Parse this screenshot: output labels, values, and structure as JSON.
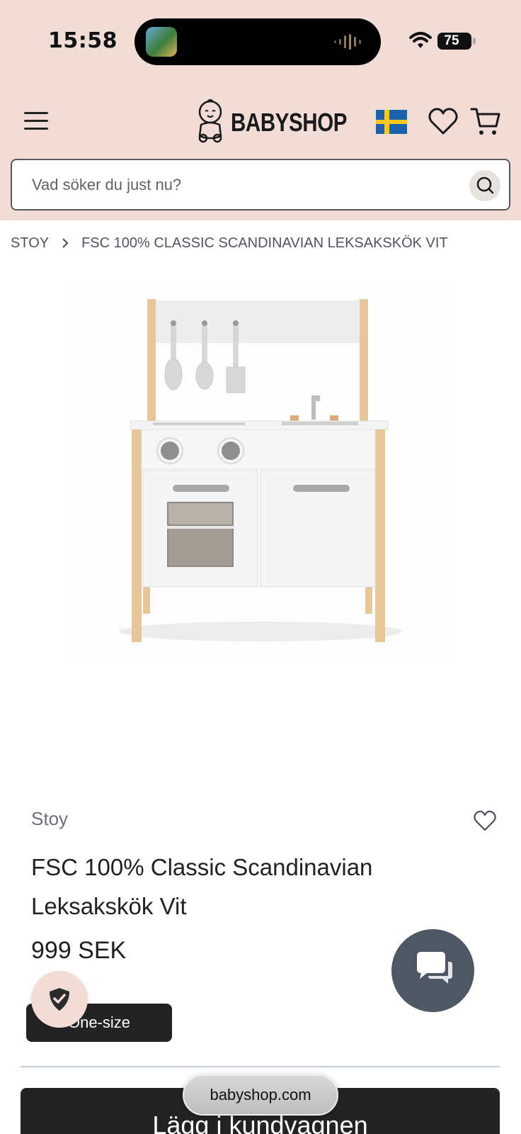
{
  "status_bar": {
    "time": "15:58",
    "battery": "75",
    "battery_level": 0.75
  },
  "header": {
    "logo_text": "BABYSHOP",
    "icons": [
      "menu-icon",
      "swedish-flag-icon",
      "heart-icon",
      "cart-icon"
    ]
  },
  "search": {
    "placeholder": "Vad söker du just nu?"
  },
  "breadcrumb": {
    "items": [
      "STOY",
      "FSC 100% CLASSIC SCANDINAVIAN LEKSAKSKÖK VIT"
    ]
  },
  "product": {
    "brand": "Stoy",
    "title": "FSC 100% Classic Scandinavian Leksakskök Vit",
    "price": "999 SEK",
    "size": "One-size",
    "add_to_cart": "Lägg i kundvagnen"
  },
  "browser": {
    "url": "babyshop.com"
  },
  "colors": {
    "header_bg": "#f2dcd6",
    "button_dark": "#232323",
    "chat_bg": "#4e5865"
  }
}
